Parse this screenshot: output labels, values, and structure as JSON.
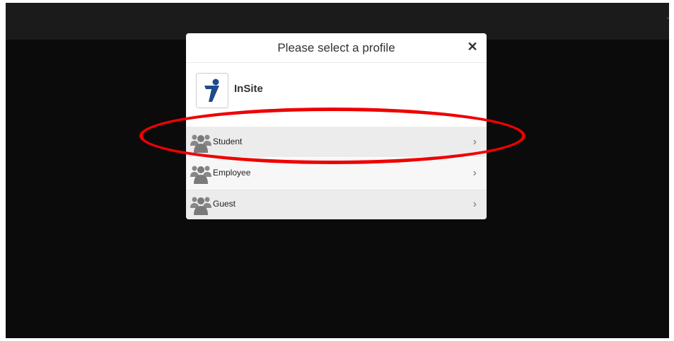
{
  "dialog": {
    "title": "Please select a profile",
    "close_icon": "close-icon"
  },
  "app": {
    "name": "InSite",
    "logo_icon": "insite-logo-icon"
  },
  "profiles": [
    {
      "label": "Student",
      "icon": "group-icon",
      "chevron": "›"
    },
    {
      "label": "Employee",
      "icon": "group-icon",
      "chevron": "›"
    },
    {
      "label": "Guest",
      "icon": "group-icon",
      "chevron": "›"
    }
  ],
  "annotation": {
    "highlight_color": "#ee0000",
    "highlighted_item": "Student"
  },
  "colors": {
    "backdrop": "#0b0b0b",
    "logo_blue": "#1f4a8c"
  }
}
